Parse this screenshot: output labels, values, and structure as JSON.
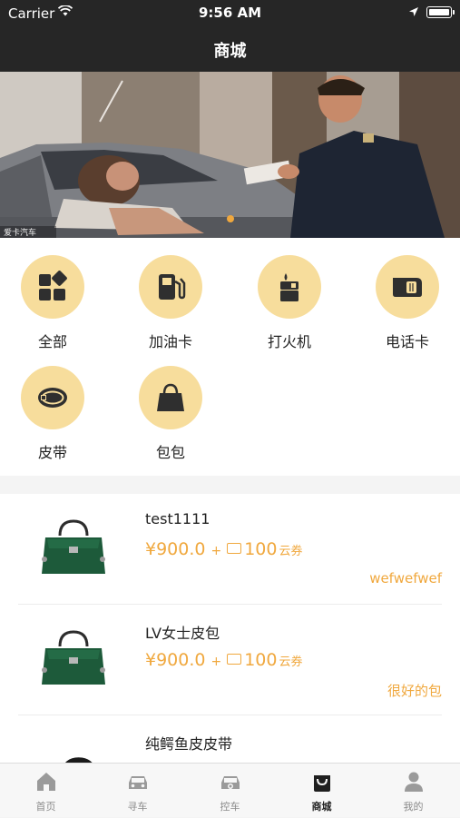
{
  "status_bar": {
    "carrier": "Carrier",
    "time": "9:56 AM"
  },
  "nav": {
    "title": "商城"
  },
  "banner": {
    "watermark": "爱卡汽车"
  },
  "categories": [
    {
      "label": "全部",
      "icon": "apps-grid-icon"
    },
    {
      "label": "加油卡",
      "icon": "fuel-pump-icon"
    },
    {
      "label": "打火机",
      "icon": "lighter-icon"
    },
    {
      "label": "电话卡",
      "icon": "sim-card-icon"
    },
    {
      "label": "皮带",
      "icon": "belt-icon"
    },
    {
      "label": "包包",
      "icon": "handbag-icon"
    }
  ],
  "products": [
    {
      "name": "test1111",
      "price": "¥900.0",
      "plus": "+",
      "points": "100",
      "points_unit": "云券",
      "desc": "wefwefwef"
    },
    {
      "name": "LV女士皮包",
      "price": "¥900.0",
      "plus": "+",
      "points": "100",
      "points_unit": "云券",
      "desc": "很好的包"
    },
    {
      "name": "纯鳄鱼皮皮带",
      "price": "",
      "plus": "",
      "points": "",
      "points_unit": "",
      "desc": ""
    }
  ],
  "tabs": [
    {
      "label": "首页",
      "icon": "home-icon",
      "active": false
    },
    {
      "label": "寻车",
      "icon": "car-search-icon",
      "active": false
    },
    {
      "label": "控车",
      "icon": "car-control-icon",
      "active": false
    },
    {
      "label": "商城",
      "icon": "shopping-bag-icon",
      "active": true
    },
    {
      "label": "我的",
      "icon": "user-icon",
      "active": false
    }
  ],
  "colors": {
    "header_bg": "#262626",
    "accent": "#f0a83e",
    "icon_circle": "#f7dd9c"
  }
}
